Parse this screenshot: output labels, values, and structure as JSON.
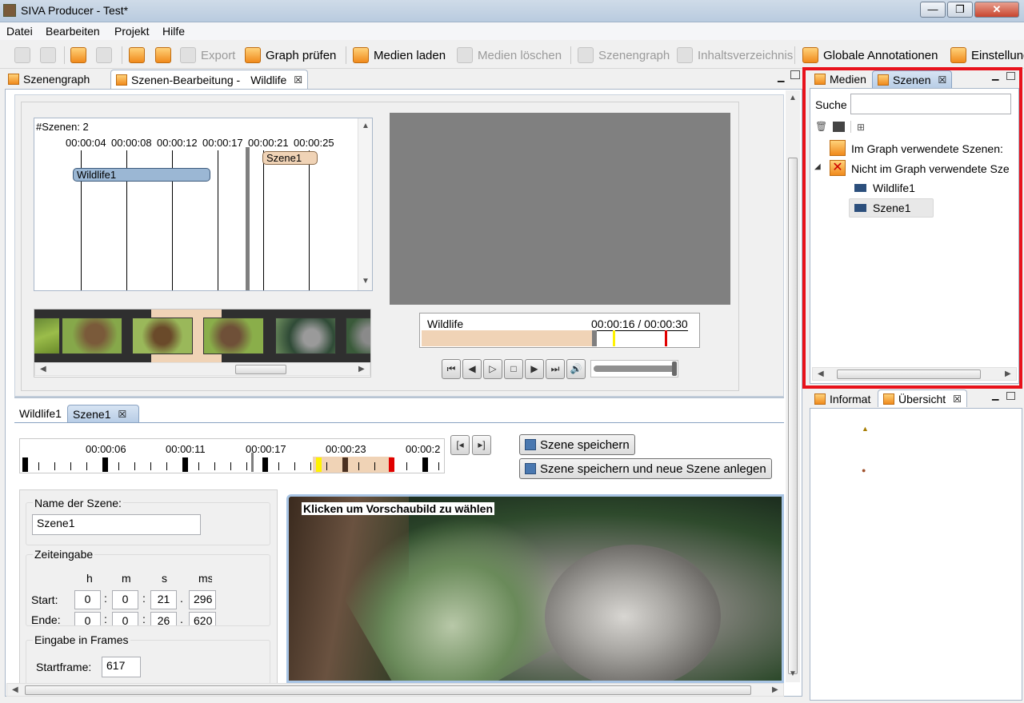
{
  "window": {
    "title": "SIVA Producer - Test*",
    "minimize": "—",
    "maximize": "❐",
    "close": "✕"
  },
  "menu": [
    "Datei",
    "Bearbeiten",
    "Projekt",
    "Hilfe"
  ],
  "toolbar": {
    "export": "Export",
    "graph_pruefen": "Graph prüfen",
    "medien_laden": "Medien laden",
    "medien_loeschen": "Medien löschen",
    "szenengraph": "Szenengraph",
    "inhaltsverzeichnis": "Inhaltsverzeichnis",
    "globale_annotationen": "Globale Annotationen",
    "einstellungen": "Einstellung"
  },
  "editor_tabs": {
    "szenengraph": "Szenengraph",
    "szenen_bearbeitung": "Szenen-Bearbeitung -",
    "wildlife": "Wildlife"
  },
  "timeline": {
    "count_label": "#Szenen: 2",
    "times": [
      "00:00:04",
      "00:00:08",
      "00:00:12",
      "00:00:17",
      "00:00:21",
      "00:00:25"
    ],
    "scene_wildlife": "Wildlife1",
    "scene_szene1": "Szene1"
  },
  "player": {
    "media": "Wildlife",
    "time": "00:00:16 / 00:00:30",
    "progress": 0.64,
    "volume_icon": "speaker-icon"
  },
  "scene_tabs": {
    "wildlife1": "Wildlife1",
    "szene1": "Szene1"
  },
  "scene_timeline": {
    "times": [
      "00:00:06",
      "00:00:11",
      "00:00:17",
      "00:00:23",
      "00:00:2"
    ]
  },
  "buttons": {
    "save": "Szene speichern",
    "save_new": "Szene speichern und neue Szene anlegen"
  },
  "form": {
    "name_group": "Name der Szene:",
    "name_value": "Szene1",
    "time_group": "Zeiteingabe",
    "cols": [
      "h",
      "m",
      "s",
      "ms"
    ],
    "start_label": "Start:",
    "end_label": "Ende:",
    "start": [
      "0",
      "0",
      "21",
      "296"
    ],
    "end": [
      "0",
      "0",
      "26",
      "620"
    ],
    "frames_group": "Eingabe in Frames",
    "startframe_label": "Startframe:",
    "startframe": "617"
  },
  "preview": {
    "hint": "Klicken um Vorschaubild zu wählen"
  },
  "right": {
    "tab_medien": "Medien",
    "tab_szenen": "Szenen",
    "search_label": "Suche",
    "search_value": "",
    "tree_used": "Im Graph verwendete Szenen:",
    "tree_unused": "Nicht im Graph verwendete Sze",
    "leaf1": "Wildlife1",
    "leaf2": "Szene1",
    "tab_info": "Informat",
    "tab_uebersicht": "Übersicht"
  },
  "colors": {
    "highlight": "#e8121b",
    "scene_blue": "#9bb7d4",
    "scene_peach": "#f0d3b6",
    "start_marker": "#fff200",
    "end_marker": "#e00000"
  }
}
